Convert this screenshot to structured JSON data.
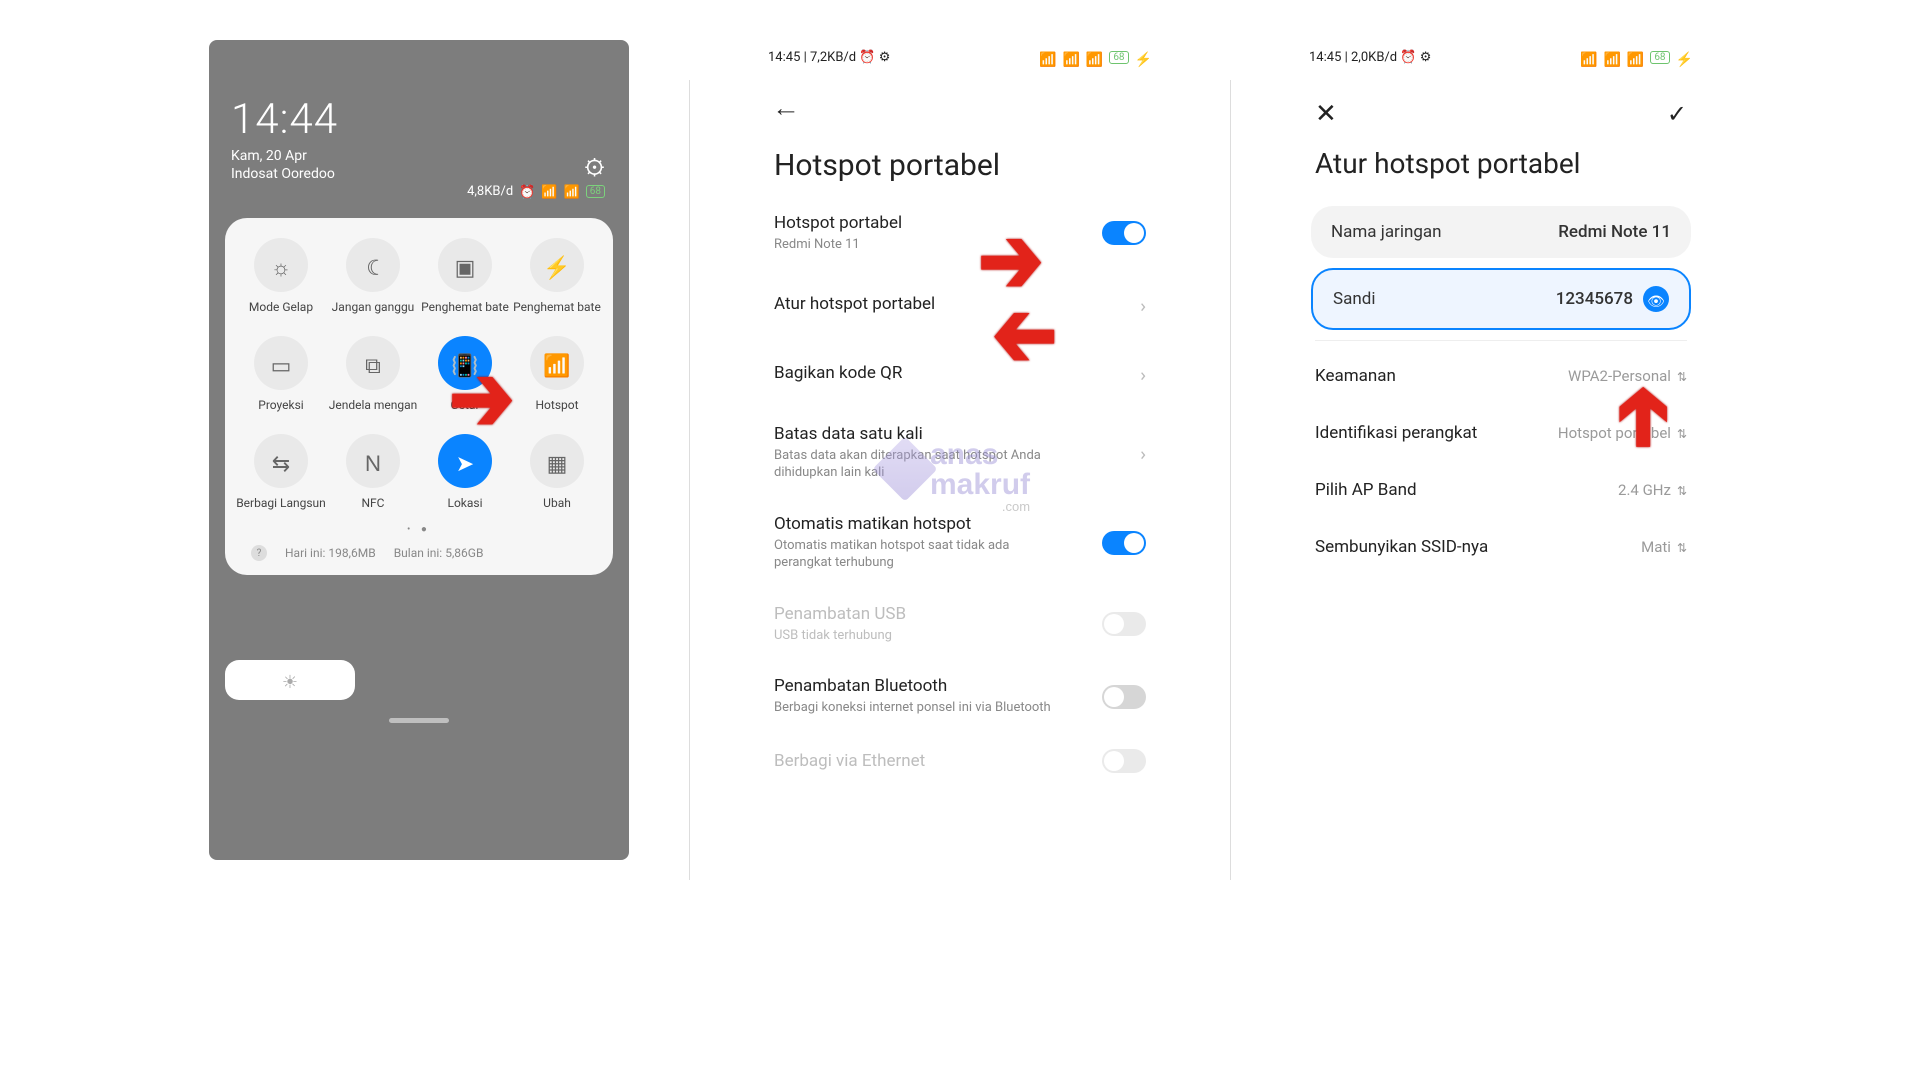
{
  "phone1": {
    "time": "14:44",
    "date": "Kam, 20 Apr",
    "carrier": "Indosat Ooredoo",
    "status_speed": "4,8KB/d",
    "battery": "68",
    "gear_icon": "⚙",
    "tiles": [
      {
        "icon": "☼",
        "label": "Mode Gelap",
        "active": false
      },
      {
        "icon": "☾",
        "label": "Jangan ganggu",
        "active": false
      },
      {
        "icon": "▣",
        "label": "Penghemat bate",
        "active": false
      },
      {
        "icon": "⚡",
        "label": "Penghemat bate",
        "active": false
      },
      {
        "icon": "▭",
        "label": "Proyeksi",
        "active": false
      },
      {
        "icon": "⧉",
        "label": "Jendela mengan",
        "active": false
      },
      {
        "icon": "📳",
        "label": "Getar",
        "active": true
      },
      {
        "icon": "📶",
        "label": "Hotspot",
        "active": false
      },
      {
        "icon": "⇆",
        "label": "Berbagi Langsun",
        "active": false
      },
      {
        "icon": "N",
        "label": "NFC",
        "active": false
      },
      {
        "icon": "➤",
        "label": "Lokasi",
        "active": true
      },
      {
        "icon": "▦",
        "label": "Ubah",
        "active": false
      }
    ],
    "data_today_label": "Hari ini:",
    "data_today": "198,6MB",
    "data_month_label": "Bulan ini:",
    "data_month": "5,86GB"
  },
  "phone2": {
    "status_left": "14:45 | 7,2KB/d ⏰ ⚙",
    "battery": "68",
    "title": "Hotspot portabel",
    "rows": [
      {
        "label": "Hotspot portabel",
        "sub": "Redmi Note 11",
        "type": "toggle",
        "on": true
      },
      {
        "label": "Atur hotspot portabel",
        "type": "chev"
      },
      {
        "label": "Bagikan kode QR",
        "type": "chev"
      },
      {
        "label": "Batas data satu kali",
        "sub": "Batas data akan diterapkan saat hotspot Anda dihidupkan lain kali",
        "type": "chev"
      },
      {
        "label": "Otomatis matikan hotspot",
        "sub": "Otomatis matikan hotspot saat tidak ada perangkat terhubung",
        "type": "toggle",
        "on": true
      },
      {
        "label": "Penambatan USB",
        "sub": "USB tidak terhubung",
        "type": "toggle",
        "on": false,
        "disabled": true
      },
      {
        "label": "Penambatan Bluetooth",
        "sub": "Berbagi koneksi internet ponsel ini via Bluetooth",
        "type": "toggle",
        "on": false
      },
      {
        "label": "Berbagi via Ethernet",
        "type": "toggle",
        "on": false,
        "disabled": true
      }
    ],
    "watermark_top": "anas",
    "watermark_bottom": "makruf",
    "watermark_dom": ".com"
  },
  "phone3": {
    "status_left": "14:45 | 2,0KB/d ⏰ ⚙",
    "battery": "68",
    "title": "Atur hotspot portabel",
    "network_label": "Nama jaringan",
    "network_value": "Redmi Note 11",
    "password_label": "Sandi",
    "password_value": "12345678",
    "opts": [
      {
        "label": "Keamanan",
        "value": "WPA2-Personal"
      },
      {
        "label": "Identifikasi perangkat",
        "value": "Hotspot portabel"
      },
      {
        "label": "Pilih AP Band",
        "value": "2.4 GHz"
      },
      {
        "label": "Sembunyikan SSID-nya",
        "value": "Mati"
      }
    ]
  }
}
